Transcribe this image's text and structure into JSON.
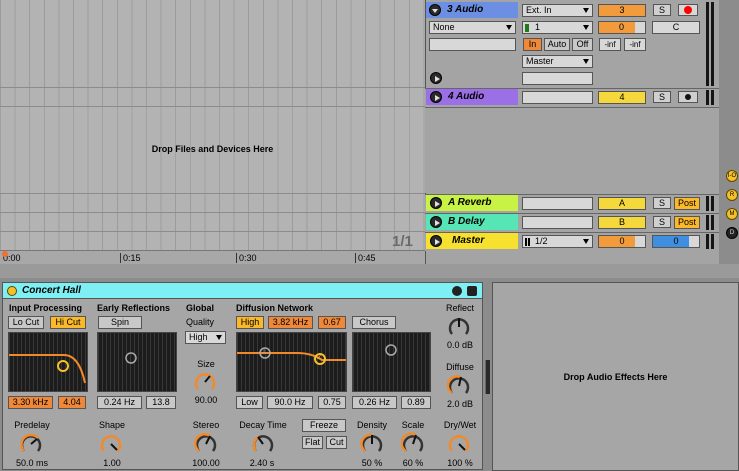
{
  "tracks": {
    "audio3": {
      "name": "3 Audio",
      "input_type": "Ext. In",
      "input_channel": "1",
      "clip_slot": "None",
      "monitor": [
        "In",
        "Auto",
        "Off"
      ],
      "output": "Master",
      "track_number": "3",
      "vol": "0",
      "pan": "C",
      "send1": "-inf",
      "send2": "-inf",
      "solo": "S"
    },
    "audio4": {
      "name": "4 Audio",
      "track_number": "4",
      "solo": "S"
    },
    "reverb": {
      "name": "A Reverb",
      "track_number": "A",
      "solo": "S",
      "post": "Post"
    },
    "delay": {
      "name": "B Delay",
      "track_number": "B",
      "solo": "S",
      "post": "Post"
    },
    "master": {
      "name": "Master",
      "ratio": "1/2",
      "vol": "0",
      "pan": "0"
    }
  },
  "arrangement": {
    "drop_text": "Drop Files and Devices Here",
    "page": "1/1",
    "timeline": [
      "0:00",
      "0:15",
      "0:30",
      "0:45"
    ]
  },
  "side_buttons": [
    "I-O",
    "R",
    "M",
    "D"
  ],
  "device": {
    "title": "Concert Hall",
    "input_processing": {
      "label": "Input Processing",
      "lo_cut": "Lo Cut",
      "hi_cut": "Hi Cut",
      "freq": "3.30 kHz",
      "q": "4.04"
    },
    "early_reflections": {
      "label": "Early Reflections",
      "spin": "Spin",
      "rate": "0.24 Hz",
      "amount": "13.8"
    },
    "global": {
      "label": "Global",
      "quality_label": "Quality",
      "quality": "High",
      "size_label": "Size",
      "size": "90.00"
    },
    "diffusion": {
      "label": "Diffusion Network",
      "high": "High",
      "high_freq": "3.82 kHz",
      "high_val": "0.67",
      "chorus": "Chorus",
      "low": "Low",
      "low_freq": "90.0 Hz",
      "low_val": "0.75",
      "chorus_rate": "0.26 Hz",
      "chorus_amt": "0.89"
    },
    "reflect": {
      "label": "Reflect",
      "value": "0.0 dB"
    },
    "diffuse": {
      "label": "Diffuse",
      "value": "2.0 dB"
    },
    "predelay": {
      "label": "Predelay",
      "value": "50.0 ms"
    },
    "shape": {
      "label": "Shape",
      "value": "1.00"
    },
    "stereo": {
      "label": "Stereo",
      "value": "100.00"
    },
    "decay": {
      "label": "Decay Time",
      "value": "2.40 s"
    },
    "freeze": {
      "freeze": "Freeze",
      "flat": "Flat",
      "cut": "Cut"
    },
    "density": {
      "label": "Density",
      "value": "50 %"
    },
    "scale": {
      "label": "Scale",
      "value": "60 %"
    },
    "drywet": {
      "label": "Dry/Wet",
      "value": "100 %"
    }
  },
  "effects_drop": "Drop Audio Effects Here",
  "colors": {
    "audio3": "#6d8fe3",
    "audio4": "#9b6fe6",
    "reverb": "#c8f244",
    "delay": "#56e6b5",
    "master": "#f5e12e",
    "device_header": "#7ef0f4"
  }
}
